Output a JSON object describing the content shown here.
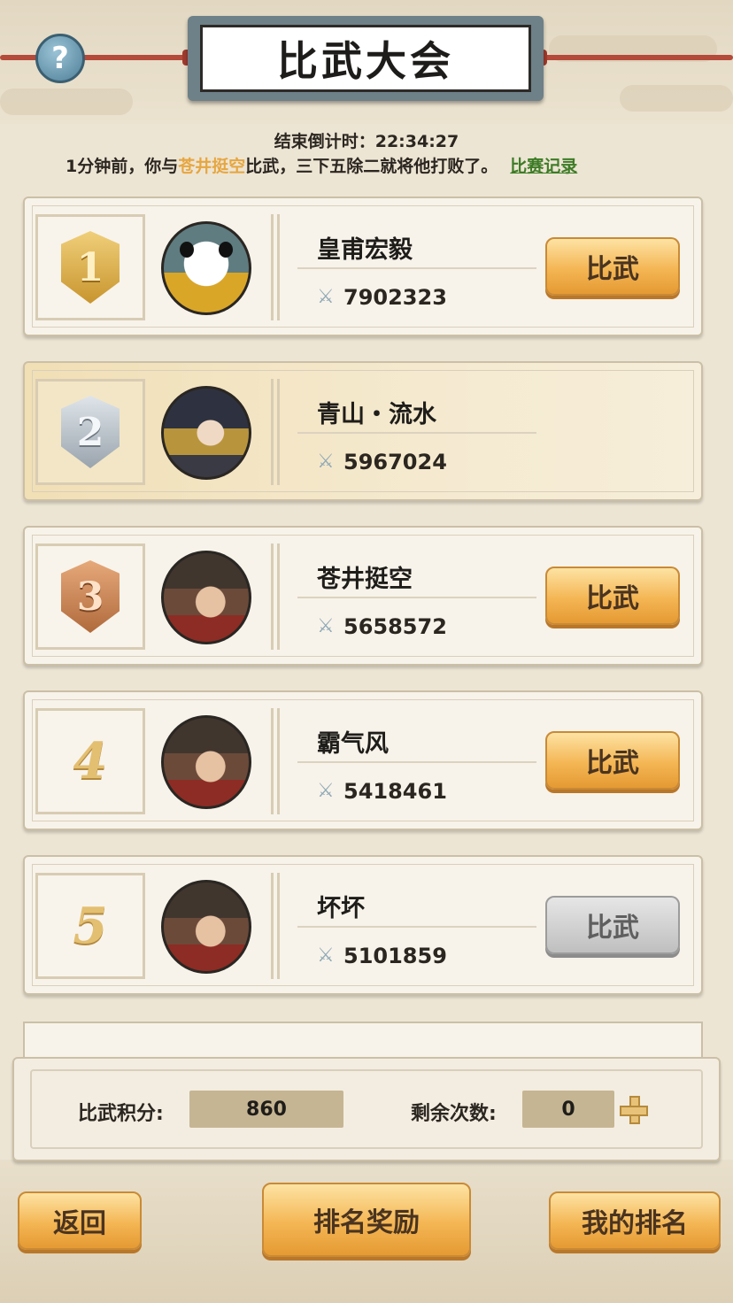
{
  "header": {
    "title": "比武大会",
    "help_icon": "question-mark-icon",
    "countdown_label": "结束倒计时：",
    "countdown_value": "22:34:27"
  },
  "notice": {
    "prefix": "1分钟前，你与",
    "opponent": "苍井挺空",
    "suffix": "比武，三下五除二就将他打败了。",
    "record_link": "比赛记录"
  },
  "ranking": [
    {
      "rank": "1",
      "name": "皇甫宏毅",
      "power": "7902323",
      "button": "比武",
      "button_enabled": true,
      "is_self": false
    },
    {
      "rank": "2",
      "name": "青山・流水",
      "power": "5967024",
      "button": "",
      "button_enabled": false,
      "is_self": true
    },
    {
      "rank": "3",
      "name": "苍井挺空",
      "power": "5658572",
      "button": "比武",
      "button_enabled": true,
      "is_self": false
    },
    {
      "rank": "4",
      "name": "霸气风",
      "power": "5418461",
      "button": "比武",
      "button_enabled": true,
      "is_self": false
    },
    {
      "rank": "5",
      "name": "坏坏",
      "power": "5101859",
      "button": "比武",
      "button_enabled": false,
      "is_self": false
    }
  ],
  "stats": {
    "score_label": "比武积分:",
    "score_value": "860",
    "remaining_label": "剩余次数:",
    "remaining_value": "0"
  },
  "footer": {
    "back": "返回",
    "rewards": "排名奖励",
    "my_rank": "我的排名"
  },
  "colors": {
    "highlight": "#e6a640",
    "link": "#3d7c26",
    "button": "#f4b654",
    "button_disabled": "#bfbfbf"
  }
}
